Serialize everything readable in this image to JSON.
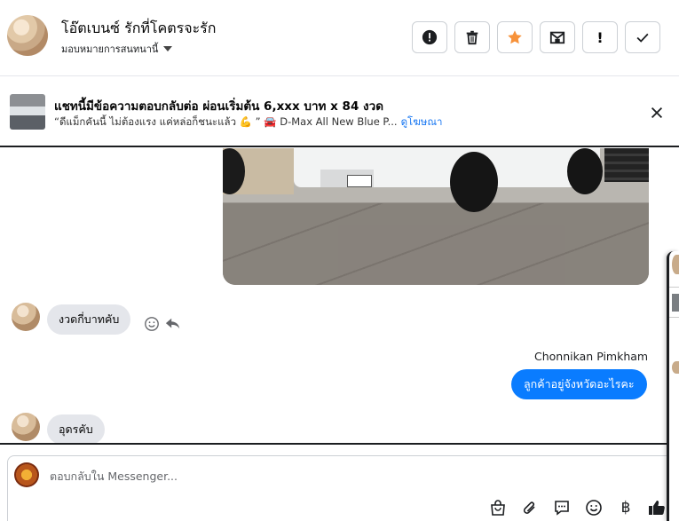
{
  "header": {
    "contact_name": "โอ๊ตเบนซ์ รักที่โคตรจะรัก",
    "assign_label": "มอบหมายการสนทนานี้",
    "actions": [
      {
        "name": "report-icon"
      },
      {
        "name": "trash-icon"
      },
      {
        "name": "star-icon",
        "color": "#f7923a"
      },
      {
        "name": "mark-unread-icon"
      },
      {
        "name": "exclamation-icon",
        "glyph": "!"
      },
      {
        "name": "checkmark-icon"
      }
    ]
  },
  "ad_banner": {
    "title": "แชทนี้มีข้อความตอบกลับต่อ ผ่อนเริ่มต้น 6,xxx บาท x 84 งวด",
    "subtitle": "“ดีแม็กคันนี้ ไม่ต้องแรง แค่หล่อก็ชนะแล้ว 💪 ” 🚘 D-Max All New Blue P...",
    "link": "ดูโฆษณา"
  },
  "messages": {
    "incoming_1": "งวดกี่บาทคับ",
    "sender_name": "Chonnikan Pimkham",
    "outgoing_1": "ลูกค้าอยู่จังหวัดอะไรคะ",
    "incoming_2": "อุดรคับ"
  },
  "composer": {
    "placeholder": "ตอบกลับใน Messenger...",
    "baht_symbol": "฿"
  },
  "colors": {
    "accent": "#0a7cff",
    "link": "#1877f2",
    "star": "#f7923a",
    "like": "#1c1e21"
  }
}
